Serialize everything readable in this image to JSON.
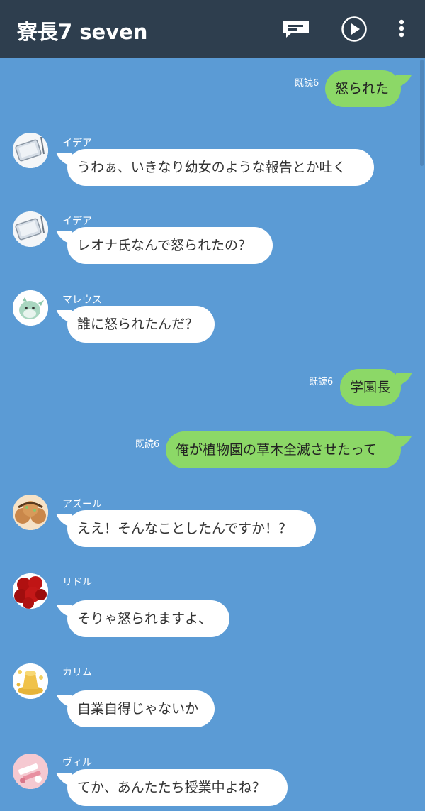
{
  "header": {
    "title": "寮長7 seven",
    "icons": [
      "notes-icon",
      "play-icon",
      "more-vert-icon"
    ]
  },
  "read_label": "既読6",
  "messages": [
    {
      "side": "out",
      "text": "怒られた",
      "read": "既読6"
    },
    {
      "side": "in",
      "sender": "イデア",
      "avatar": "tablet-avatar",
      "text": "うわぁ、いきなり幼女のような報告とか吐く"
    },
    {
      "side": "in",
      "sender": "イデア",
      "avatar": "tablet-avatar",
      "text": "レオナ氏なんで怒られたの？"
    },
    {
      "side": "in",
      "sender": "マレウス",
      "avatar": "dragon-avatar",
      "text": "誰に怒られたんだ？"
    },
    {
      "side": "out",
      "text": "学園長",
      "read": "既読6"
    },
    {
      "side": "out",
      "text": "俺が植物園の草木全滅させたって",
      "read": "既読6"
    },
    {
      "side": "in",
      "sender": "アズール",
      "avatar": "takoyaki-avatar",
      "text": "ええ！そんなことしたんですか！？"
    },
    {
      "side": "in",
      "sender": "リドル",
      "avatar": "roses-avatar",
      "text": "そりゃ怒られますよ、"
    },
    {
      "side": "in",
      "sender": "カリム",
      "avatar": "gold-avatar",
      "text": "自業自得じゃないか"
    },
    {
      "side": "in",
      "sender": "ヴィル",
      "avatar": "cosmetics-avatar",
      "text": "てか、あんたたち授業中よね？"
    }
  ],
  "colors": {
    "background": "#5b9bd5",
    "header": "#2e3e4e",
    "outgoing_bubble": "#8cd867",
    "incoming_bubble": "#ffffff"
  }
}
